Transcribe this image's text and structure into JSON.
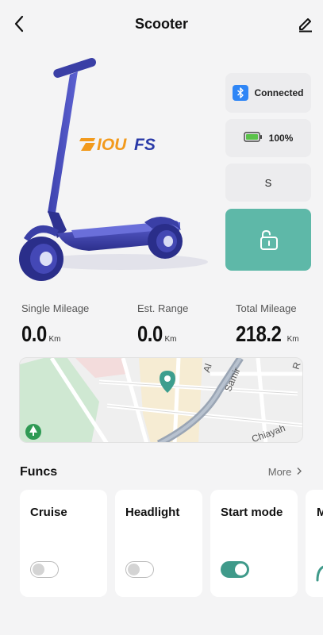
{
  "header": {
    "title": "Scooter"
  },
  "hero": {
    "brand": "IOUFS"
  },
  "status": {
    "bluetooth_label": "Connected",
    "battery_label": "100%",
    "battery_level": 1.0,
    "mode_label": "S"
  },
  "stats": [
    {
      "label": "Single Mileage",
      "value": "0.0",
      "unit": "Km"
    },
    {
      "label": "Est. Range",
      "value": "0.0",
      "unit": "Km"
    },
    {
      "label": "Total Mileage",
      "value": "218.2",
      "unit": "Km"
    }
  ],
  "map": {
    "street_1": "Al",
    "street_2": "Samir",
    "street_3": "Chiayah",
    "street_4": "R"
  },
  "funcs": {
    "title": "Funcs",
    "more_label": "More",
    "items": [
      {
        "label": "Cruise",
        "on": false
      },
      {
        "label": "Headlight",
        "on": false
      },
      {
        "label": "Start mode",
        "on": true
      },
      {
        "label": "M"
      }
    ]
  },
  "colors": {
    "accent": "#5eb8a8",
    "toggle_on": "#3f9a8a",
    "bluetooth": "#2f86f6",
    "scooter": "#3a3fa6",
    "brand_orange": "#f29a1c",
    "brand_blue": "#2a3aa8"
  }
}
